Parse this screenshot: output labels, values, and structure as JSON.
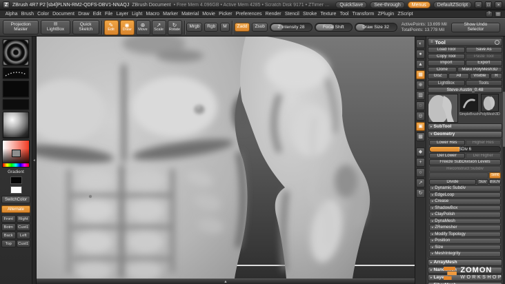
{
  "colors": {
    "accent": "#d9852d",
    "accent_bright": "#f0a545"
  },
  "titlebar": {
    "logo": "Z",
    "title": "ZBrush 4R7 P2 [sb4]PLNN-RM2-QDFS-DBV1-NNAQJ",
    "doc": "ZBrush Document",
    "stats": "• Free Mem 4.096GB  • Active Mem 4285  • Scratch Disk 9171  • ZTimer 1.374",
    "quicksave": "QuickSave",
    "see_through": "See-through",
    "menus": "Menus",
    "zscript": "DefaultZScript",
    "minimize": "–",
    "maximize": "□",
    "close": "×"
  },
  "menubar": {
    "items": [
      "Alpha",
      "Brush",
      "Color",
      "Document",
      "Draw",
      "Edit",
      "File",
      "Layer",
      "Light",
      "Macro",
      "Marker",
      "Material",
      "Movie",
      "Picker",
      "Preferences",
      "Render",
      "Stencil",
      "Stroke",
      "Texture",
      "Tool",
      "Transform",
      "ZPlugin",
      "ZScript"
    ],
    "help": "?",
    "layout": "▤"
  },
  "shelf": {
    "projection_master": "Projection Master",
    "lightbox": "LightBox",
    "lightbox_icon": "▤",
    "quick_sketch": "Quick Sketch",
    "tools": [
      {
        "label": "Edit",
        "glyph": "✎",
        "name": "edit-mode-button",
        "active": true
      },
      {
        "label": "Draw",
        "glyph": "◉",
        "name": "draw-mode-button",
        "active": true
      },
      {
        "label": "Move",
        "glyph": "⊕",
        "name": "move-mode-button"
      },
      {
        "label": "Scale",
        "glyph": "↗",
        "name": "scale-mode-button"
      },
      {
        "label": "Rotate",
        "glyph": "↻",
        "name": "rotate-mode-button"
      }
    ],
    "mrgb": "Mrgb",
    "rgb": "Rgb",
    "m": "M",
    "zadd": "Zadd",
    "zsub": "Zsub",
    "z_intensity": "Z Intensity 28",
    "focal_shift": "Focal Shift",
    "draw_size": "Draw Size 32",
    "active_points": "ActivePoints: 13.699 Mil",
    "total_points": "TotalPoints: 13.778 Mil",
    "show_undo": "Show Undo Selector"
  },
  "left_tray": {
    "gradient_label": "Gradient",
    "switch_color": "SwitchColor",
    "alternate": "Alternate",
    "views": [
      {
        "a": "Front",
        "b": "Right"
      },
      {
        "a": "Botm",
        "b": "Cust1"
      },
      {
        "a": "Back",
        "b": "Left"
      },
      {
        "a": "Top",
        "b": "Cust1"
      }
    ]
  },
  "right_strip": {
    "icons": [
      {
        "name": "bpr-render-icon",
        "glyph": "◐"
      },
      {
        "name": "render-preview-icon",
        "glyph": "●"
      },
      {
        "name": "perspective-icon",
        "glyph": "▲"
      },
      {
        "name": "floor-grid-icon",
        "glyph": "▦",
        "active": true
      },
      {
        "name": "local-symmetry-icon",
        "glyph": "⊕"
      },
      {
        "name": "transparency-icon",
        "glyph": "▥"
      },
      {
        "name": "ghost-icon",
        "glyph": "◌"
      },
      {
        "name": "solo-icon",
        "glyph": "◎"
      },
      {
        "name": "frame-icon",
        "glyph": "▣",
        "active": true
      },
      {
        "name": "polyframe-icon",
        "glyph": "▩"
      },
      {
        "name": "silhouette-icon",
        "glyph": "◆"
      },
      {
        "name": "scroll-doc-icon",
        "glyph": "+"
      },
      {
        "name": "zoom-doc-icon",
        "glyph": "○"
      },
      {
        "name": "scale-doc-icon",
        "glyph": "↗"
      },
      {
        "name": "rotate-view-icon",
        "glyph": "↻"
      }
    ]
  },
  "tool_palette": {
    "header": "Tool",
    "load_tool": "Load Tool",
    "save_as": "Save As",
    "copy_tool": "Copy Tool",
    "paste_tool": "Paste Tool",
    "import": "Import",
    "export": "Export",
    "clone": "Clone",
    "make_polymesh": "Make PolyMesh3D",
    "goz": "GoZ",
    "all": "All",
    "visible": "Visible",
    "r": "R",
    "lightbox_label": "LightBox",
    "lightbox_target": "Tools",
    "current_tool": "Steve-Austin_0.48",
    "recent_1": "SimpleBrush",
    "recent_2": "PolyMesh3D",
    "subtool_header": "SubTool",
    "geometry_header": "Geometry",
    "geometry": {
      "lower_res": "Lower Res",
      "higher_res": "Higher Res",
      "sdiv": "SDiv 6",
      "del_lower": "Del Lower",
      "del_higher": "Del Higher",
      "freeze": "Freeze SubDivision Levels",
      "reconstruct": "Reconstruct Subdiv",
      "smt": "Smt",
      "divide": "Divide",
      "suv": "Suv",
      "bsuv": "BsUV",
      "subsections": [
        "Dynamic Subdiv",
        "EdgeLoop",
        "Crease",
        "ShadowBox",
        "ClayPolish",
        "DynaMesh",
        "ZRemesher",
        "Modify Topology",
        "Position",
        "Size",
        "MeshIntegrity"
      ]
    },
    "bottom_sections": [
      "ArrayMesh",
      "NanoMesh",
      "Layers",
      "FiberMesh"
    ]
  },
  "canvas": {
    "tray_arrow": "◂",
    "bottom_arrow": "▲"
  },
  "watermark": {
    "line1": "ZOMON",
    "line2": "WORKSHOP"
  }
}
